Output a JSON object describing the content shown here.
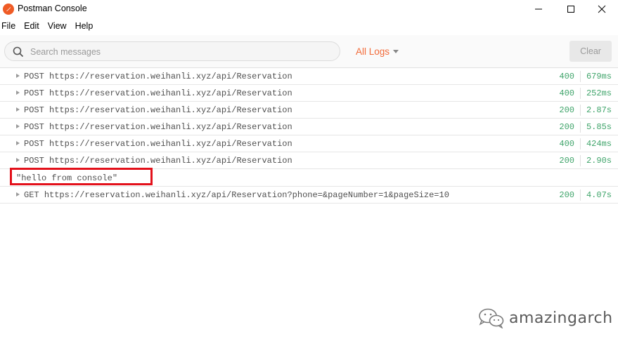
{
  "window": {
    "title": "Postman Console"
  },
  "menu": [
    "File",
    "Edit",
    "View",
    "Help"
  ],
  "toolbar": {
    "search_placeholder": "Search messages",
    "filter_label": "All Logs",
    "clear_label": "Clear"
  },
  "logs": [
    {
      "method": "POST",
      "url": "https://reservation.weihanli.xyz/api/Reservation",
      "status": "400",
      "time": "679ms"
    },
    {
      "method": "POST",
      "url": "https://reservation.weihanli.xyz/api/Reservation",
      "status": "400",
      "time": "252ms"
    },
    {
      "method": "POST",
      "url": "https://reservation.weihanli.xyz/api/Reservation",
      "status": "200",
      "time": "2.87s"
    },
    {
      "method": "POST",
      "url": "https://reservation.weihanli.xyz/api/Reservation",
      "status": "200",
      "time": "5.85s"
    },
    {
      "method": "POST",
      "url": "https://reservation.weihanli.xyz/api/Reservation",
      "status": "400",
      "time": "424ms"
    },
    {
      "method": "POST",
      "url": "https://reservation.weihanli.xyz/api/Reservation",
      "status": "200",
      "time": "2.90s"
    }
  ],
  "console_message": "\"hello from console\"",
  "last_log": {
    "method": "GET",
    "url": "https://reservation.weihanli.xyz/api/Reservation?phone=&pageNumber=1&pageSize=10",
    "status": "200",
    "time": "4.07s"
  },
  "watermark": {
    "text": "amazingarch"
  },
  "colors": {
    "accent": "#f26b3a",
    "status_ok": "#3fa46a",
    "highlight": "#e3111b"
  }
}
